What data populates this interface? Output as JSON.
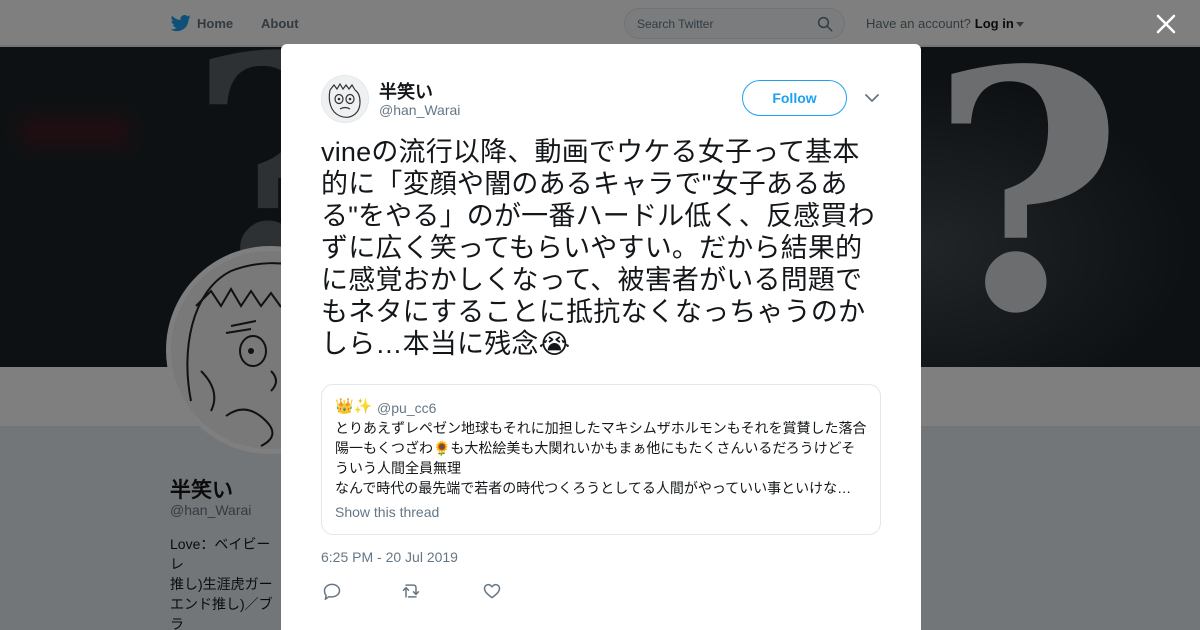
{
  "nav": {
    "home_label": "Home",
    "about_label": "About",
    "search_placeholder": "Search Twitter",
    "account_prompt": "Have an account?",
    "login_label": "Log in"
  },
  "profile": {
    "name": "半笑い",
    "handle": "@han_Warai",
    "bio": "Love：ベイビーレ\n推し)生涯虎ガー\n エンド推し)／ブラ\nDe(今永推し)／競\n ◆一橋大→"
  },
  "tweet": {
    "author_name": "半笑い",
    "author_handle": "@han_Warai",
    "follow_label": "Follow",
    "text": "vineの流行以降、動画でウケる女子って基本的に「変顔や闇のあるキャラで\"女子あるある\"をやる」のが一番ハードル低く、反感買わずに広く笑ってもらいやすい。だから結果的に感覚おかしくなって、被害者がいる問題でもネタにすることに抵抗なくなっちゃうのかしら…本当に残念😭",
    "timestamp": "6:25 PM - 20 Jul 2019",
    "quote": {
      "emoji": "👑✨",
      "handle": "@pu_cc6",
      "lines": [
        "とりあえずレペゼン地球もそれに加担したマキシムザホルモンもそれを賞賛した落合",
        "陽一もくつざわ🌻も大松絵美も大関れいかもまぁ他にもたくさんいるだろうけどそ",
        "ういう人間全員無理",
        "なんで時代の最先端で若者の時代つくろうとしてる人間がやっていい事といけな…"
      ],
      "show_thread_label": "Show this thread"
    }
  },
  "colors": {
    "twitter_blue": "#1da1f2",
    "text_primary": "#14171a",
    "text_secondary": "#657786",
    "border": "#e1e8ed"
  },
  "icons": [
    "twitter-bird-icon",
    "search-icon",
    "chevron-down-icon",
    "close-icon",
    "reply-icon",
    "retweet-icon",
    "like-icon"
  ]
}
